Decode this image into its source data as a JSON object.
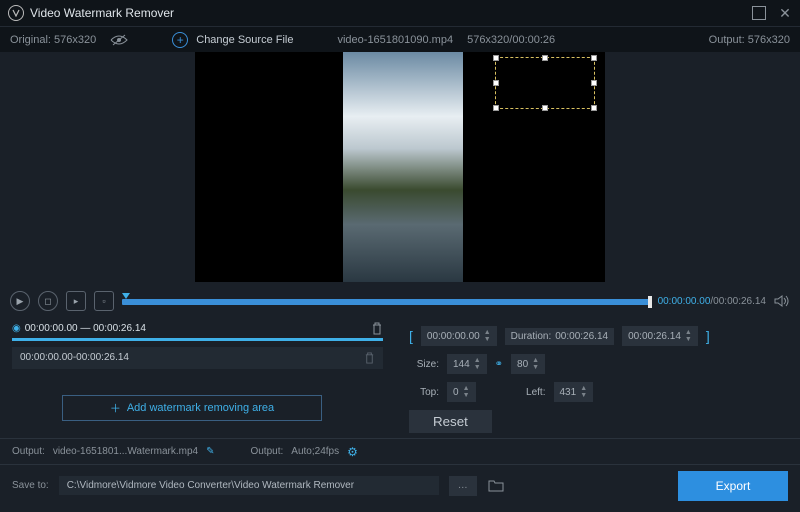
{
  "titlebar": {
    "title": "Video Watermark Remover"
  },
  "infobar": {
    "original_label": "Original:",
    "original_dim": "576x320",
    "change_source": "Change Source File",
    "filename": "video-1651801090.mp4",
    "filemeta": "576x320/00:00:26",
    "output_label": "Output:",
    "output_dim": "576x320"
  },
  "playbar": {
    "current": "00:00:00.00",
    "total": "/00:00:26.14"
  },
  "segments": {
    "range_start": "00:00:00.00",
    "range_sep": "—",
    "range_end": "00:00:26.14",
    "item": "00:00:00.00-00:00:26.14",
    "add_label": "Add watermark removing area"
  },
  "params": {
    "start_time": "00:00:00.00",
    "duration_label": "Duration:",
    "duration_val": "00:00:26.14",
    "end_time": "00:00:26.14",
    "size_label": "Size:",
    "width": "144",
    "height": "80",
    "top_label": "Top:",
    "top": "0",
    "left_label": "Left:",
    "left": "431",
    "reset": "Reset"
  },
  "outputrow": {
    "out_label": "Output:",
    "out_file": "video-1651801...Watermark.mp4",
    "out_label2": "Output:",
    "out_settings": "Auto;24fps"
  },
  "bottombar": {
    "saveto_label": "Save to:",
    "path": "C:\\Vidmore\\Vidmore Video Converter\\Video Watermark Remover",
    "export": "Export"
  }
}
